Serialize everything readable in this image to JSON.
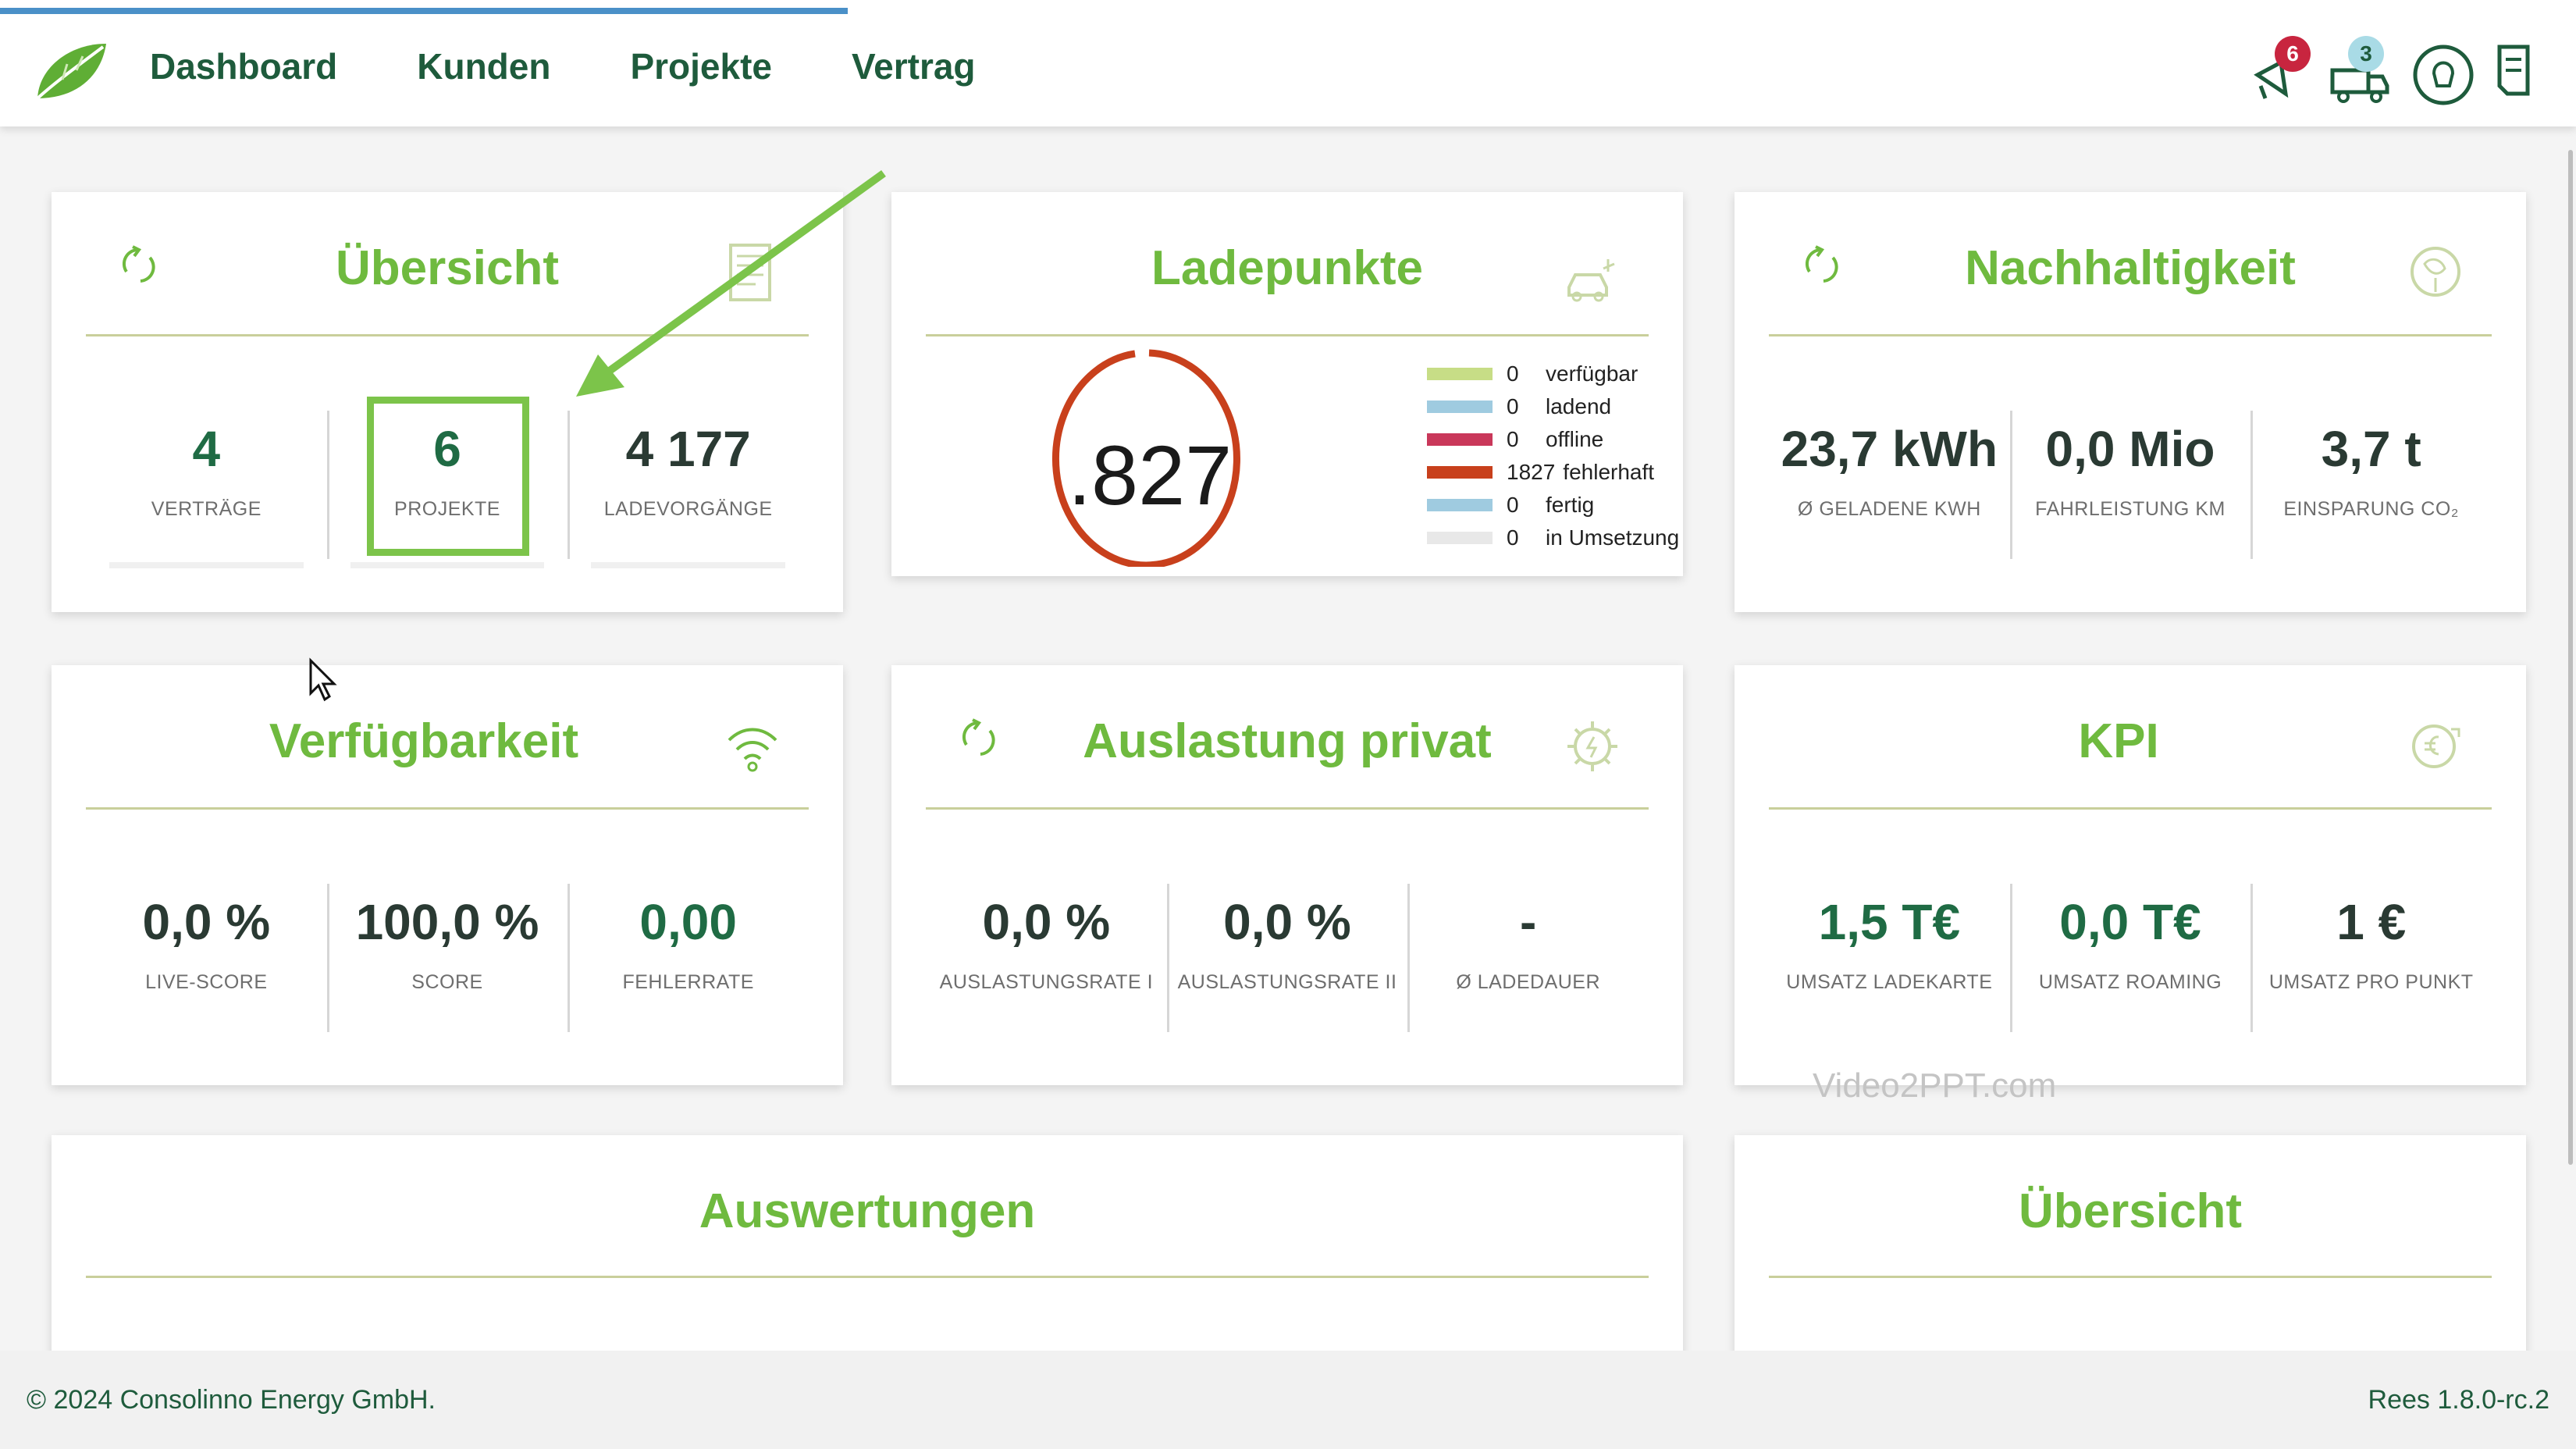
{
  "nav": {
    "items": [
      "Dashboard",
      "Kunden",
      "Projekte",
      "Vertrag"
    ]
  },
  "header_icons": {
    "notifications_badge": "6",
    "shipping_badge": "3"
  },
  "cards": {
    "uebersicht": {
      "title": "Übersicht",
      "metrics": [
        {
          "value": "4",
          "label": "VERTRÄGE"
        },
        {
          "value": "6",
          "label": "PROJEKTE"
        },
        {
          "value": "4 177",
          "label": "LADEVORGÄNGE"
        }
      ]
    },
    "ladepunkte": {
      "title": "Ladepunkte",
      "donut_value": ".827",
      "legend": [
        {
          "count": "0",
          "label": "verfügbar",
          "color": "#c7dd86"
        },
        {
          "count": "0",
          "label": "ladend",
          "color": "#9fcbe0"
        },
        {
          "count": "0",
          "label": "offline",
          "color": "#c9385a"
        },
        {
          "count": "1827",
          "label": "fehlerhaft",
          "color": "#c8401c"
        },
        {
          "count": "0",
          "label": "fertig",
          "color": "#9fcbe0"
        },
        {
          "count": "0",
          "label": "in Umsetzung",
          "color": "#e8e8e8"
        }
      ]
    },
    "nachhaltigkeit": {
      "title": "Nachhaltigkeit",
      "metrics": [
        {
          "value": "23,7 kWh",
          "label": "Ø GELADENE KWH"
        },
        {
          "value": "0,0 Mio",
          "label": "FAHRLEISTUNG KM"
        },
        {
          "value": "3,7 t",
          "label": "EINSPARUNG CO₂"
        }
      ]
    },
    "verfuegbarkeit": {
      "title": "Verfügbarkeit",
      "metrics": [
        {
          "value": "0,0 %",
          "label": "LIVE-SCORE"
        },
        {
          "value": "100,0 %",
          "label": "SCORE"
        },
        {
          "value": "0,00",
          "label": "FEHLERRATE"
        }
      ]
    },
    "auslastung": {
      "title": "Auslastung privat",
      "metrics": [
        {
          "value": "0,0 %",
          "label": "AUSLASTUNGSRATE I"
        },
        {
          "value": "0,0 %",
          "label": "AUSLASTUNGSRATE II"
        },
        {
          "value": "-",
          "label": "Ø LADEDAUER"
        }
      ]
    },
    "kpi": {
      "title": "KPI",
      "metrics": [
        {
          "value": "1,5 T€",
          "label": "UMSATZ LADEKARTE"
        },
        {
          "value": "0,0 T€",
          "label": "UMSATZ ROAMING"
        },
        {
          "value": "1 €",
          "label": "UMSATZ PRO PUNKT"
        }
      ]
    },
    "auswertungen": {
      "title": "Auswertungen"
    },
    "uebersicht2": {
      "title": "Übersicht"
    }
  },
  "watermark": "Video2PPT.com",
  "footer": {
    "copyright": "© 2024 Consolinno Energy GmbH.",
    "version": "Rees 1.8.0-rc.2"
  },
  "colors": {
    "brand_dark": "#1e5b3c",
    "brand_light": "#6fba3f",
    "highlight": "#7cc44a",
    "donut_ring": "#c8401c"
  }
}
